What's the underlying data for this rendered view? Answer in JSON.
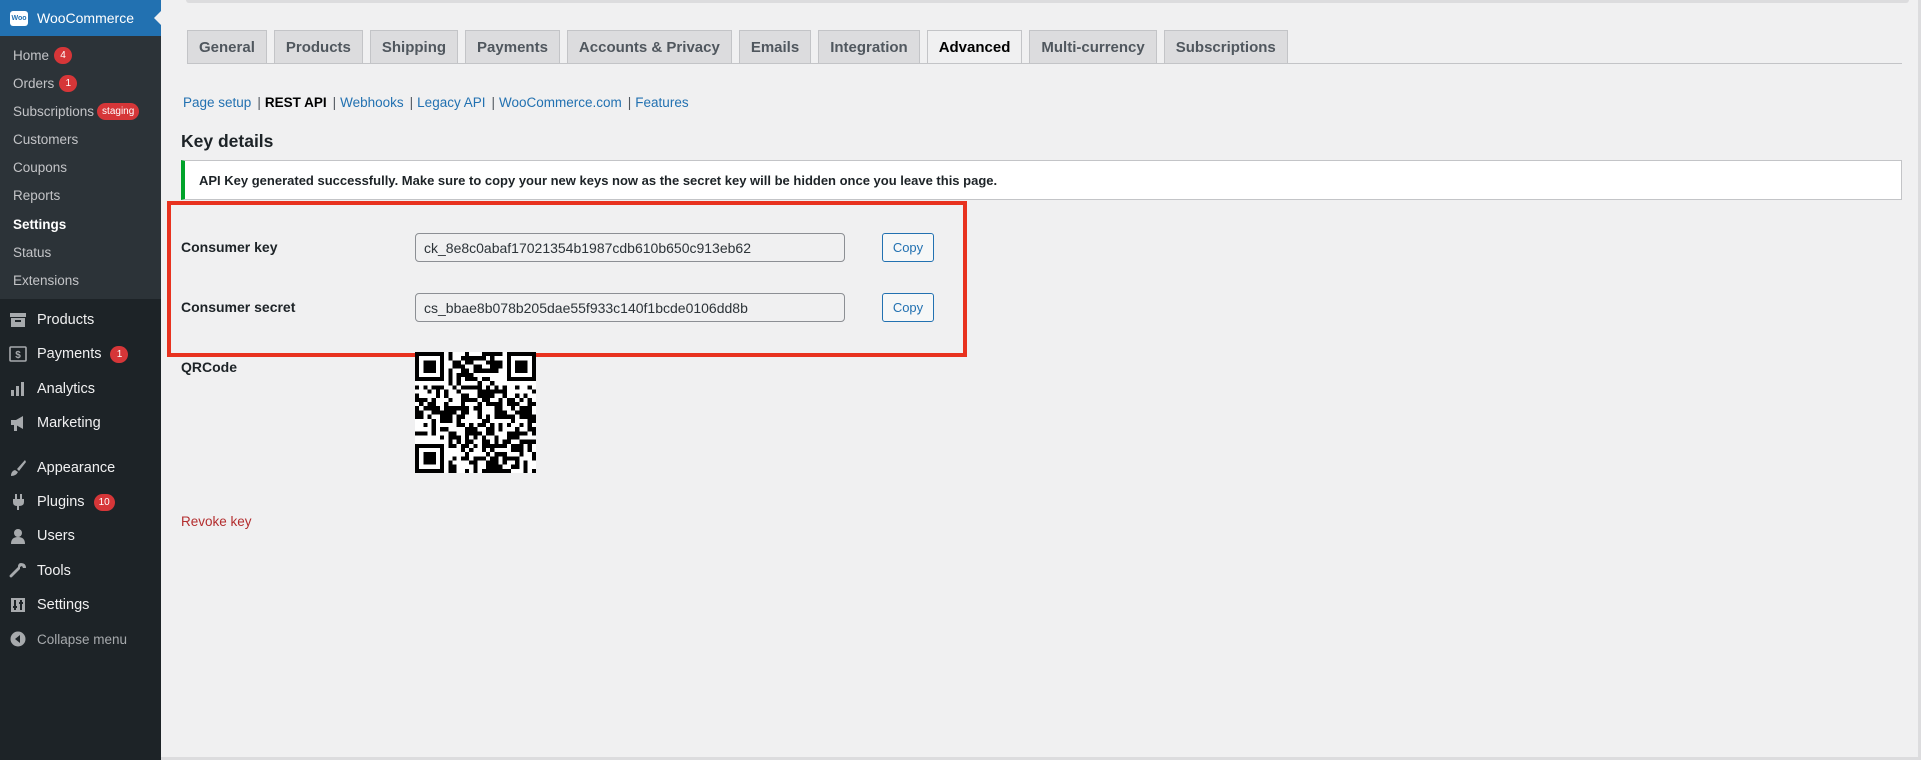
{
  "sidebar": {
    "brand": "WooCommerce",
    "brand_logo": "Woo",
    "submenu": [
      {
        "label": "Home",
        "badge": "4"
      },
      {
        "label": "Orders",
        "badge": "1"
      },
      {
        "label": "Subscriptions",
        "badge": "staging"
      },
      {
        "label": "Customers"
      },
      {
        "label": "Coupons"
      },
      {
        "label": "Reports"
      },
      {
        "label": "Settings"
      },
      {
        "label": "Status"
      },
      {
        "label": "Extensions"
      }
    ],
    "menu": [
      {
        "label": "Products",
        "icon": "archive-icon"
      },
      {
        "label": "Payments",
        "icon": "dollar-icon",
        "badge": "1"
      },
      {
        "label": "Analytics",
        "icon": "bar-chart-icon"
      },
      {
        "label": "Marketing",
        "icon": "megaphone-icon"
      },
      {
        "label": "Appearance",
        "icon": "paintbrush-icon"
      },
      {
        "label": "Plugins",
        "icon": "plug-icon",
        "badge": "10"
      },
      {
        "label": "Users",
        "icon": "user-icon"
      },
      {
        "label": "Tools",
        "icon": "wrench-icon"
      },
      {
        "label": "Settings",
        "icon": "settings-icon"
      }
    ],
    "collapse": "Collapse menu"
  },
  "tabs": [
    "General",
    "Products",
    "Shipping",
    "Payments",
    "Accounts & Privacy",
    "Emails",
    "Integration",
    "Advanced",
    "Multi-currency",
    "Subscriptions"
  ],
  "active_tab": "Advanced",
  "subsections": [
    "Page setup",
    "REST API",
    "Webhooks",
    "Legacy API",
    "WooCommerce.com",
    "Features"
  ],
  "active_subsection": "REST API",
  "page": {
    "heading": "Key details",
    "notice": "API Key generated successfully. Make sure to copy your new keys now as the secret key will be hidden once you leave this page.",
    "consumer_key_label": "Consumer key",
    "consumer_key_value": "ck_8e8c0abaf17021354b1987cdb610b650c913eb62",
    "consumer_secret_label": "Consumer secret",
    "consumer_secret_value": "cs_bbae8b078b205dae55f933c140f1bcde0106dd8b",
    "copy_label": "Copy",
    "qr_label": "QRCode",
    "revoke_label": "Revoke key"
  },
  "colors": {
    "accent": "#2271b1",
    "sidebar_bg": "#1d2327",
    "badge": "#d63638",
    "success": "#00a32a",
    "highlight": "#e8321f",
    "danger": "#b32d2e"
  }
}
